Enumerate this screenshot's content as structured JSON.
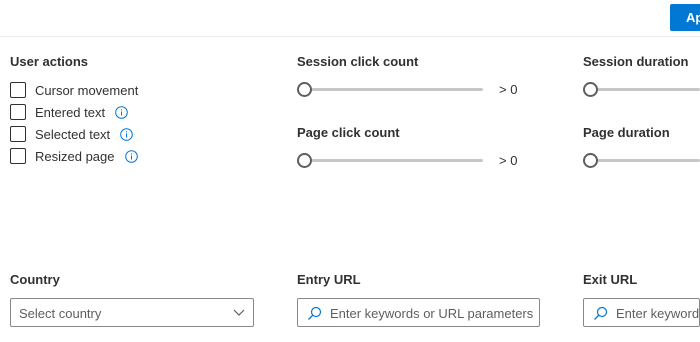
{
  "header": {
    "apply_label": "Ap"
  },
  "user_actions": {
    "title": "User actions",
    "items": [
      {
        "label": "Cursor movement",
        "checked": false,
        "info": false
      },
      {
        "label": "Entered text",
        "checked": false,
        "info": true
      },
      {
        "label": "Selected text",
        "checked": false,
        "info": true
      },
      {
        "label": "Resized page",
        "checked": false,
        "info": true
      }
    ]
  },
  "session_click_count": {
    "title": "Session click count",
    "value_label": "> 0",
    "level": 0
  },
  "page_click_count": {
    "title": "Page click count",
    "value_label": "> 0",
    "level": 0
  },
  "session_duration": {
    "title": "Session duration",
    "level": 0
  },
  "page_duration": {
    "title": "Page duration",
    "level": 0
  },
  "country": {
    "title": "Country",
    "placeholder": "Select country"
  },
  "entry_url": {
    "title": "Entry URL",
    "placeholder": "Enter keywords or URL parameters"
  },
  "exit_url": {
    "title": "Exit URL",
    "placeholder": "Enter keywords or URL parameters"
  },
  "colors": {
    "accent": "#0078d4",
    "border": "#8a8886",
    "info_icon": "#0078d4"
  }
}
